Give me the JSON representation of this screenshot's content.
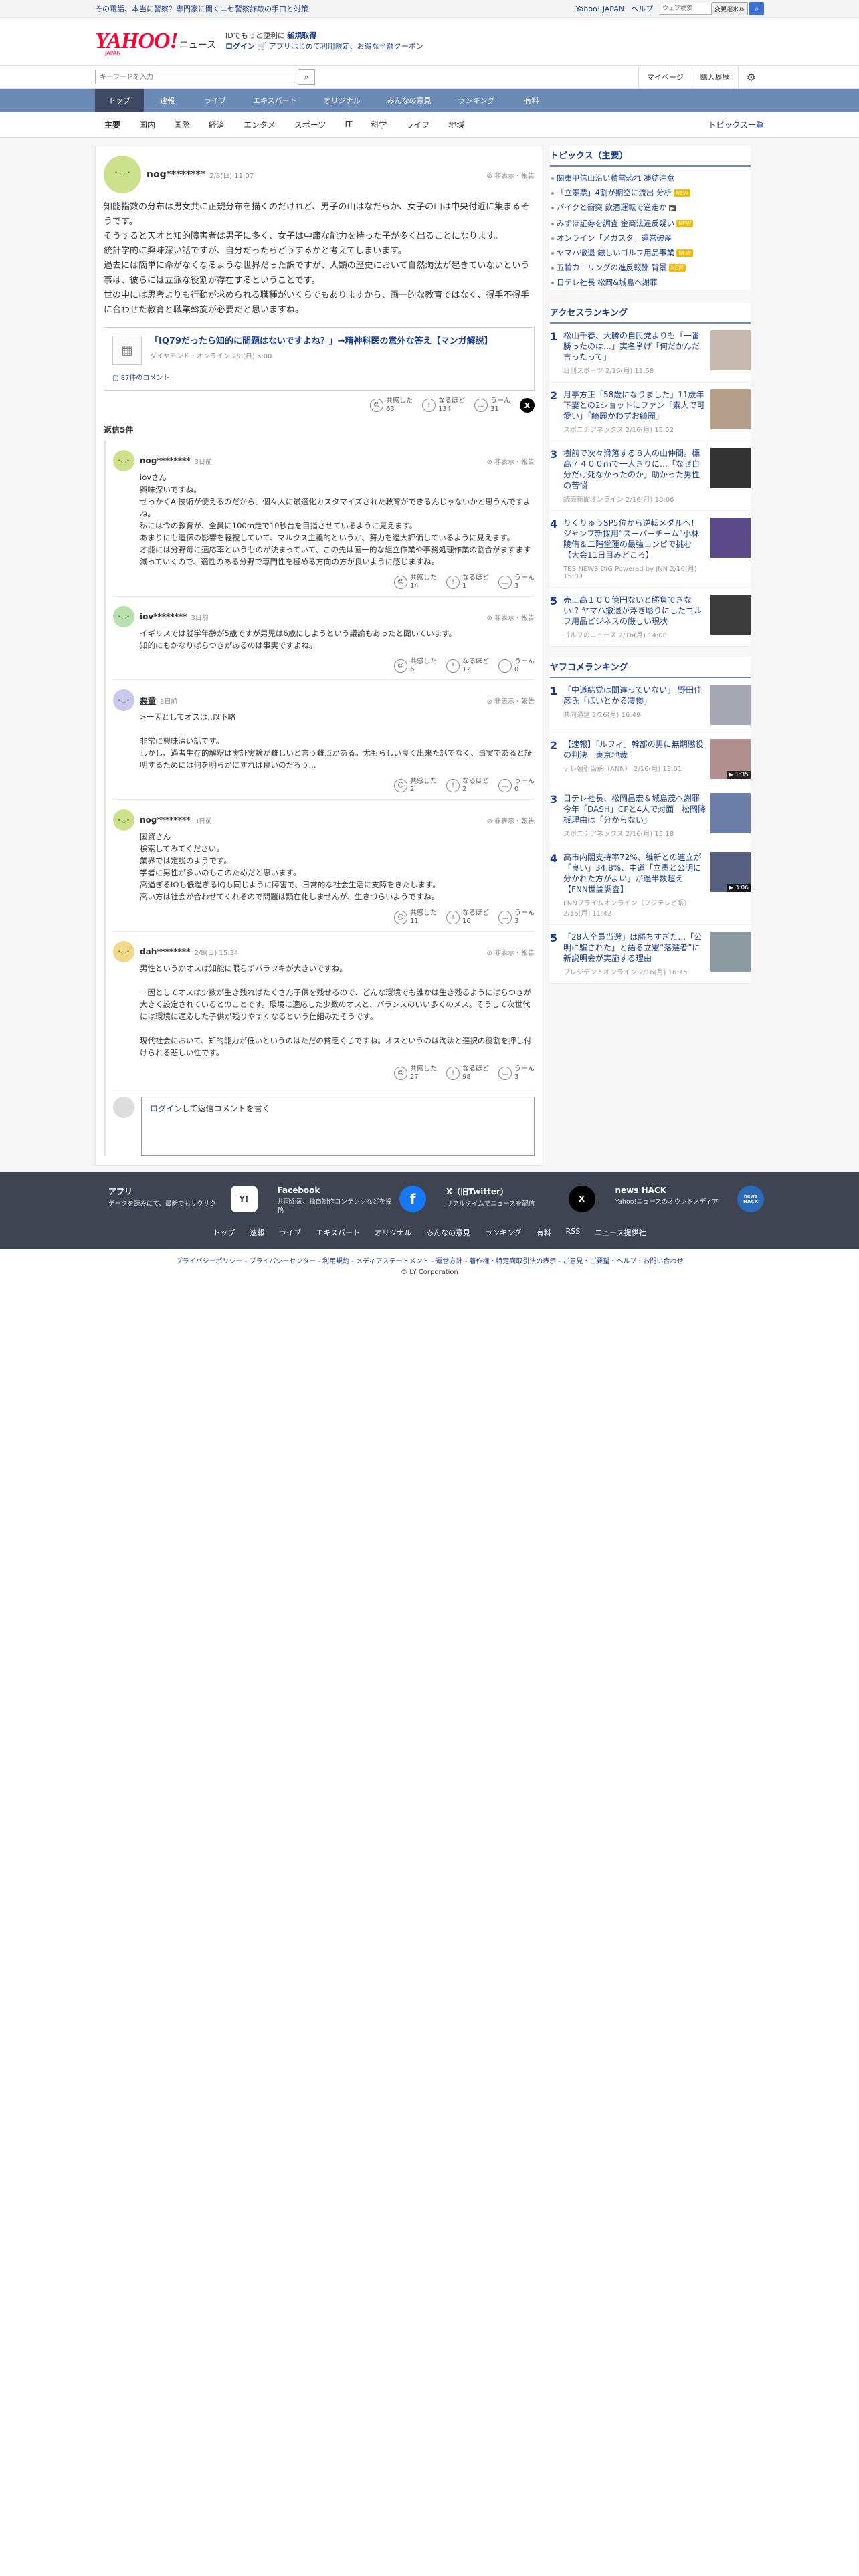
{
  "topbar": {
    "promo": "その電話、本当に警察？専門家に聞くニセ警察詐欺の手口と対策",
    "links": [
      "Yahoo! JAPAN",
      "ヘルプ"
    ],
    "search_placeholder": "ウェブ検索",
    "search_label": "変更遷水ル"
  },
  "brand": {
    "logo": "YAHOO!",
    "logo_sub": "JAPAN",
    "section": "ニュース",
    "tagline_pre": "IDでもっと便利に",
    "signup": "新規取得",
    "login": "ログイン",
    "coupon": "アプリはじめて利用限定、お得な半額クーポン"
  },
  "searchrow": {
    "placeholder": "キーワードを入力",
    "mypage": "マイページ",
    "history": "購入履歴"
  },
  "nav": [
    "トップ",
    "速報",
    "ライブ",
    "エキスパート",
    "オリジナル",
    "みんなの意見",
    "ランキング",
    "有料"
  ],
  "subnav": [
    "主要",
    "国内",
    "国際",
    "経済",
    "エンタメ",
    "スポーツ",
    "IT",
    "科学",
    "ライフ",
    "地域"
  ],
  "subnav_all": "トピックス一覧",
  "comment": {
    "user": "nog********",
    "date": "2/8(日) 11:07",
    "report": "非表示・報告",
    "body": "知能指数の分布は男女共に正規分布を描くのだけれど、男子の山はなだらか、女子の山は中央付近に集まるそうです。\nそうすると天才と知的障害者は男子に多く、女子は中庸な能力を持った子が多く出ることになります。\n統計学的に興味深い話ですが、自分だったらどうするかと考えてしまいます。\n過去には簡単に命がなくなるような世界だった訳ですが、人類の歴史において自然淘汰が起きていないという事は、彼らには立派な役割が存在するということです。\n世の中には思考よりも行動が求められる職種がいくらでもありますから、画一的な教育ではなく、得手不得手に合わせた教育と職業斡旋が必要だと思いますね。",
    "article_title": "「IQ79だったら知的に問題はないですよね？」→精神科医の意外な答え【マンガ解説】",
    "article_source": "ダイヤモンド・オンライン 2/8(日) 6:00",
    "comment_count": "87件のコメント",
    "reactions": [
      {
        "label": "共感した",
        "count": "63"
      },
      {
        "label": "なるほど",
        "count": "134"
      },
      {
        "label": "うーん",
        "count": "31"
      }
    ]
  },
  "reply_heading": "返信5件",
  "replies": [
    {
      "user": "nog********",
      "date": "3日前",
      "body": "iovさん\n興味深いですね。\nせっかくAI技術が使えるのだから、個々人に最適化カスタマイズされた教育ができるんじゃないかと思うんですよね。\n私には今の教育が、全員に100m走で10秒台を目指させているように見えます。\nあまりにも遺伝の影響を軽視していて、マルクス主義的というか、努力を過大評価しているように見えます。\n才能には分野毎に適応率というものが決まっていて、この先は画一的な組立作業や事務処理作業の割合がますます減っていくので、適性のある分野で専門性を極める方向の方が良いように感じますね。",
      "reactions": [
        {
          "label": "共感した",
          "count": "14"
        },
        {
          "label": "なるほど",
          "count": "1"
        },
        {
          "label": "うーん",
          "count": "3"
        }
      ]
    },
    {
      "user": "iov********",
      "date": "3日前",
      "body": "イギリスでは就学年齢が5歳ですが男児は6歳にしようという議論もあったと聞いています。\n知的にもかなりばらつきがあるのは事実ですよね。",
      "reactions": [
        {
          "label": "共感した",
          "count": "6"
        },
        {
          "label": "なるほど",
          "count": "12"
        },
        {
          "label": "うーん",
          "count": "0"
        }
      ]
    },
    {
      "user": "悪童",
      "date": "3日前",
      "body": ">一因としてオスは..以下略\n\n非常に興味深い話です。\nしかし、過者生存的解釈は実証実験が難しいと言う難点がある。尤もらしい良く出来た話でなく、事実であると証明するためには何を明らかにすれば良いのだろう...",
      "reactions": [
        {
          "label": "共感した",
          "count": "2"
        },
        {
          "label": "なるほど",
          "count": "2"
        },
        {
          "label": "うーん",
          "count": "0"
        }
      ]
    },
    {
      "user": "nog********",
      "date": "3日前",
      "body": "国資さん\n検索してみてください。\n業界では定説のようです。\n学者に男性が多いのもこのためだと思います。\n高過ぎるIQも低過ぎるIQも同じように障害で、日常的な社会生活に支障をきたします。\n高い方は社会が合わせてくれるので問題は顕在化しませんが、生きづらいようですね。",
      "reactions": [
        {
          "label": "共感した",
          "count": "11"
        },
        {
          "label": "なるほど",
          "count": "16"
        },
        {
          "label": "うーん",
          "count": "3"
        }
      ]
    },
    {
      "user": "dah********",
      "date": "2/8(日) 15:34",
      "body": "男性というかオスは知能に限らずバラツキが大きいですね。\n\n一因としてオスは少数が生き残ればたくさん子供を残せるので、どんな環境でも誰かは生き残るようにばらつきが大きく設定されているとのことです。環境に適応した少数のオスと、バランスのいい多くのメス。そうして次世代には環境に適応した子供が残りやすくなるという仕組みだそうです。\n\n現代社会において、知的能力が低いというのはただの貧乏くじですね。オスというのは淘汰と選択の役割を押し付けられる悲しい性です。",
      "reactions": [
        {
          "label": "共感した",
          "count": "27"
        },
        {
          "label": "なるほど",
          "count": "98"
        },
        {
          "label": "うーん",
          "count": "3"
        }
      ]
    }
  ],
  "login_prompt_link": "ログイン",
  "login_prompt_rest": "して返信コメントを書く",
  "topics": {
    "title": "トピックス（主要）",
    "items": [
      {
        "text": "関東甲信山沿い積雪恐れ 凍結注意",
        "tag": ""
      },
      {
        "text": "「立憲票」4割が期空に流出 分析",
        "tag": "NEW"
      },
      {
        "text": "バイクと衝突 飲酒運転で逆走か",
        "tag": "camera"
      },
      {
        "text": "みずほ証券を調査 金商法違反疑い",
        "tag": "NEW"
      },
      {
        "text": "オンライン「メガスタ」運営破産",
        "tag": ""
      },
      {
        "text": "ヤマハ徹退 厳しいゴルフ用品事業",
        "tag": "NEW"
      },
      {
        "text": "五輪カーリングの進反報酬 背景",
        "tag": "NEW"
      },
      {
        "text": "日テレ社長 松岡&城島へ謝罪",
        "tag": ""
      }
    ]
  },
  "access_ranking": {
    "title": "アクセスランキング",
    "items": [
      {
        "num": "1",
        "headline": "松山千春、大勝の自民党よりも「一番勝ったのは…」実名挙げ「何だかんだ言ったって」",
        "source": "日刊スポーツ 2/16(月) 11:58",
        "dur": ""
      },
      {
        "num": "2",
        "headline": "月亭方正「58歳になりました」11歳年下妻との2ショットにファン「素人で可愛い」「綺麗かわずお綺麗」",
        "source": "スポニチアネックス 2/16(月) 15:52",
        "dur": ""
      },
      {
        "num": "3",
        "headline": "樹前で次々滑落する８人の山仲間。標高７４００ｍで一人きりに…「なぜ自分だけ死なかったのか」助かった男性の苦悩",
        "source": "読売新聞オンライン 2/16(月) 10:06",
        "dur": ""
      },
      {
        "num": "4",
        "headline": "りくりゅうSP5位から逆転メダルへ！ジャンプ新採用“スーパーチーム”小林陵侑＆二階堂蓮の最強コンビで挑む【大会11日目みどころ】",
        "source": "TBS NEWS DIG Powered by JNN 2/16(月) 15:09",
        "dur": ""
      },
      {
        "num": "5",
        "headline": "売上高１００億円ないと勝負できない!? ヤマハ撤退が浮き彫りにしたゴルフ用品ビジネスの厳しい現状",
        "source": "ゴルフのニュース 2/16(月) 14:00",
        "dur": ""
      }
    ]
  },
  "yahoo_ranking": {
    "title": "ヤフコメランキング",
    "items": [
      {
        "num": "1",
        "headline": "「中道結党は間違っていない」 野田佳彦氏「ほいとかる凄惨」",
        "source": "共同通信 2/16(月) 16:49",
        "dur": ""
      },
      {
        "num": "2",
        "headline": "【速報】「ルフィ」幹部の男に無期懲役の判決　東京地裁",
        "source": "テレ朝引当系（ANN） 2/16(月) 13:01",
        "dur": "1:35"
      },
      {
        "num": "3",
        "headline": "日テレ社長、松岡昌宏＆城島茂へ謝罪　今年「DASH」CPと4人で対面　松岡降板理由は「分からない」",
        "source": "スポニチアネックス 2/16(月) 15:18",
        "dur": ""
      },
      {
        "num": "4",
        "headline": "高市内閣支持率72%、維新との連立が「良い」34.8%、中道「立憲と公明に分かれた方がよい」が過半数超え【FNN世論調査】",
        "source": "FNNプライムオンライン（フジテレビ系） 2/16(月) 11:42",
        "dur": "3:06"
      },
      {
        "num": "5",
        "headline": "「28人全員当選」は勝ちすぎた…「公明に騙された」と語る立憲“落選者”に新説明会が実施する理由",
        "source": "プレジデントオンライン 2/16(月) 16:15",
        "dur": ""
      }
    ]
  },
  "footer": {
    "apps": [
      {
        "title": "アプリ",
        "desc": "データを読みにて、最新でもサクサク",
        "icon": "Y!"
      },
      {
        "title": "Facebook",
        "desc": "共同企画、独自制作コンテンツなどを投稿",
        "icon": "f"
      },
      {
        "title": "X（旧Twitter）",
        "desc": "リアルタイムでニュースを配信",
        "icon": "X"
      },
      {
        "title": "news HACK",
        "desc": "Yahoo!ニュースのオウンドメディア",
        "icon": "news HACK"
      }
    ],
    "nav": [
      "トップ",
      "速報",
      "ライブ",
      "エキスパート",
      "オリジナル",
      "みんなの意見",
      "ランキング",
      "有料",
      "RSS",
      "ニュース提供社"
    ],
    "legal": "プライバシーポリシー - プライバシーセンター - 利用規約 - メディアステートメント - 運営方針 - 著作権・特定商取引法の表示 - ご意見・ご要望・ヘルプ・お問い合わせ",
    "copyright": "© LY Corporation"
  },
  "colors": {
    "nav": "#6b8ab5",
    "nav_active": "#3e4a63",
    "link": "#1a3d8f",
    "footer": "#3e4452",
    "accent_red": "#ff0033"
  }
}
